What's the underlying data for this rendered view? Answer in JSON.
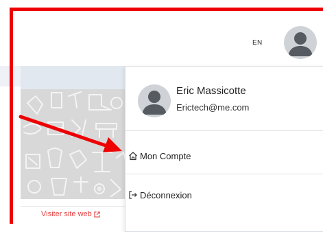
{
  "header": {
    "language": "EN",
    "avatar_icon": "user-avatar-icon"
  },
  "card": {
    "visit_label": "Visiter site web",
    "visit_icon": "external-link-icon"
  },
  "dropdown": {
    "user_name": "Eric Massicotte",
    "user_email": "Erictech@me.com",
    "items": [
      {
        "label": "Mon Compte",
        "icon": "home-icon"
      },
      {
        "label": "Déconnexion",
        "icon": "logout-icon"
      }
    ]
  },
  "annotation": {
    "color": "#ee0000"
  }
}
